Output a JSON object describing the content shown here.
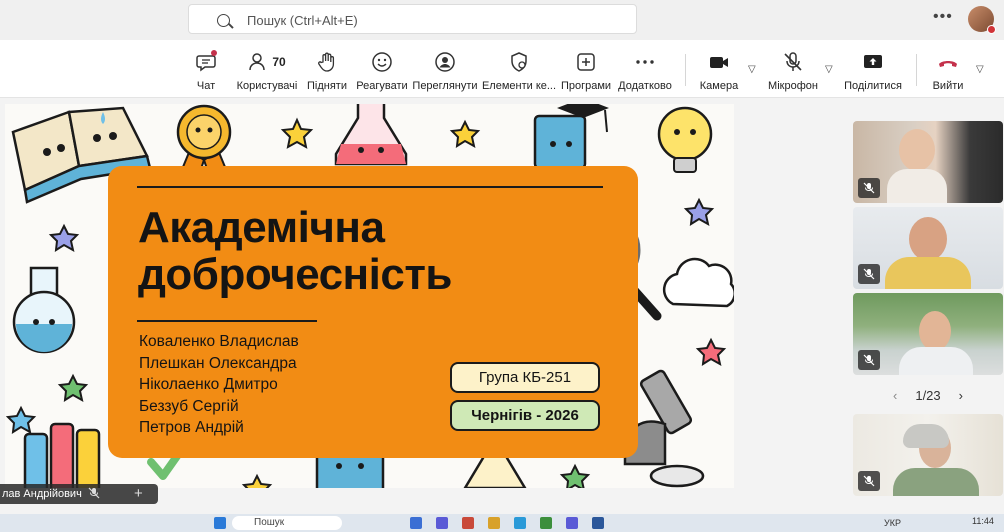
{
  "titlebar": {
    "search_placeholder": "Пошук (Ctrl+Alt+E)"
  },
  "toolbar": {
    "items": [
      {
        "label": "Чат",
        "icon": "chat-icon"
      },
      {
        "label": "Користувачі",
        "icon": "people-icon",
        "count": "70"
      },
      {
        "label": "Підняти",
        "icon": "raise-hand-icon"
      },
      {
        "label": "Реагувати",
        "icon": "smile-icon"
      },
      {
        "label": "Переглянути",
        "icon": "view-icon"
      },
      {
        "label": "Елементи ке...",
        "icon": "shield-icon"
      },
      {
        "label": "Програми",
        "icon": "apps-plus-icon"
      },
      {
        "label": "Додатково",
        "icon": "more-icon"
      },
      {
        "label": "Камера",
        "icon": "camera-icon"
      },
      {
        "label": "Мікрофон",
        "icon": "mic-off-icon"
      },
      {
        "label": "Поділитися",
        "icon": "share-icon"
      },
      {
        "label": "Вийти",
        "icon": "hangup-icon"
      }
    ]
  },
  "slide": {
    "title_line1": "Академічна",
    "title_line2": "доброчесність",
    "names": [
      "Коваленко Владислав",
      "Плешкан Олександра",
      "Ніколаенко Дмитро",
      "Беззуб Сергій",
      "Петров Андрій"
    ],
    "group": "Група КБ-251",
    "city": "Чернігів - 2026"
  },
  "panel": {
    "pager": "1/23"
  },
  "speaker": {
    "name": "лав Андрійович"
  },
  "taskbar": {
    "search": "Пошук",
    "lang": "УКР",
    "time": "11:44"
  },
  "colors": {
    "accent_orange": "#f28c14",
    "group_pill": "#fdf2c9",
    "city_pill": "#cfe9b6",
    "hangup_red": "#c4314b"
  }
}
